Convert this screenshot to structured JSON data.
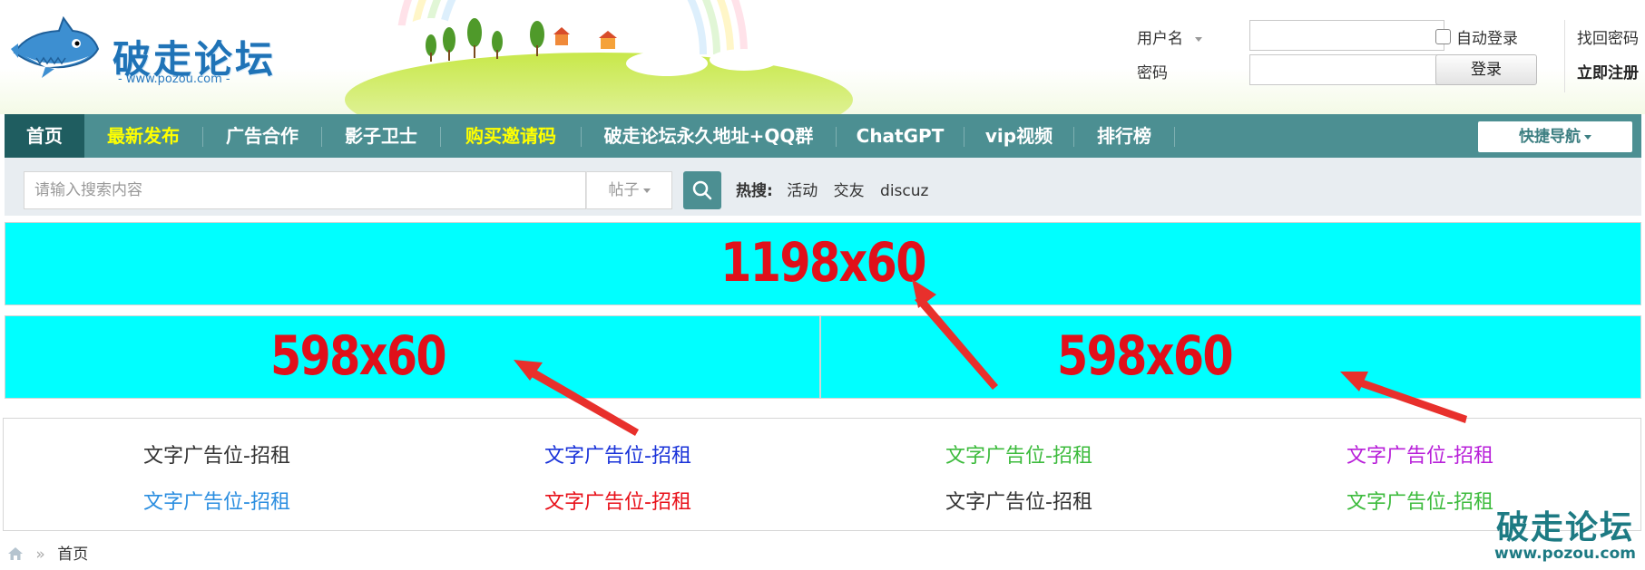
{
  "header": {
    "logo": {
      "title": "破走论坛",
      "url": "- www.pozou.com -"
    },
    "login": {
      "username_label": "用户名",
      "password_label": "密码",
      "auto_login": "自动登录",
      "login_button": "登录",
      "find_password": "找回密码",
      "register": "立即注册"
    }
  },
  "nav": {
    "items": [
      {
        "label": "首页",
        "active": true
      },
      {
        "label": "最新发布",
        "highlight": true
      },
      {
        "label": "广告合作"
      },
      {
        "label": "影子卫士"
      },
      {
        "label": "购买邀请码",
        "highlight": true
      },
      {
        "label": "破走论坛永久地址+QQ群"
      },
      {
        "label": "ChatGPT"
      },
      {
        "label": "vip视频"
      },
      {
        "label": "排行榜"
      }
    ],
    "quick_nav": "快捷导航"
  },
  "search": {
    "placeholder": "请输入搜索内容",
    "type": "帖子",
    "hot_label": "热搜:",
    "hot_keywords": [
      "活动",
      "交友",
      "discuz"
    ]
  },
  "ads": {
    "banner_full": "1198x60",
    "banner_left": "598x60",
    "banner_right": "598x60"
  },
  "text_ads": [
    {
      "text": "文字广告位-招租",
      "color": "#333333"
    },
    {
      "text": "文字广告位-招租",
      "color": "#1a33d9"
    },
    {
      "text": "文字广告位-招租",
      "color": "#3dbb3d"
    },
    {
      "text": "文字广告位-招租",
      "color": "#b81fd9"
    },
    {
      "text": "文字广告位-招租",
      "color": "#2b8ee0"
    },
    {
      "text": "文字广告位-招租",
      "color": "#e8111a"
    },
    {
      "text": "文字广告位-招租",
      "color": "#333333"
    },
    {
      "text": "文字广告位-招租",
      "color": "#3dbb3d"
    }
  ],
  "breadcrumb": {
    "sep": "»",
    "current": "首页"
  },
  "watermark": {
    "title": "破走论坛",
    "url": "www.pozou.com"
  },
  "colors": {
    "nav_bg": "#4c8f92",
    "nav_active": "#1f5d60",
    "highlight": "#ffff00",
    "ad_bg": "#00ffff",
    "ad_text": "#e0101a",
    "arrow": "#e8302c"
  }
}
